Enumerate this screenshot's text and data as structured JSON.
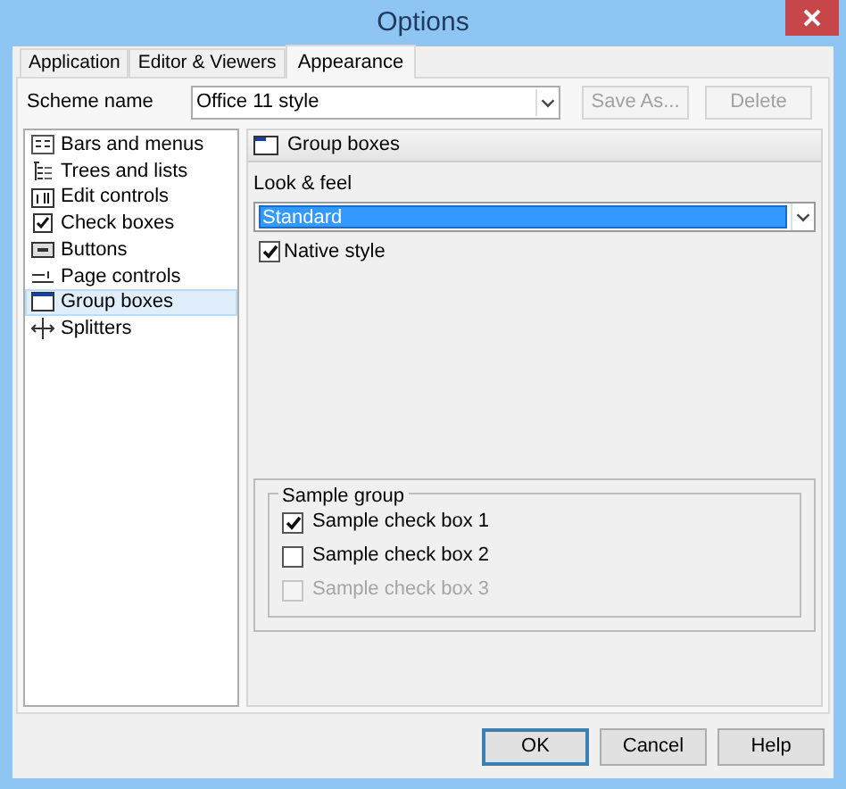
{
  "window": {
    "title": "Options"
  },
  "tabs": [
    {
      "label": "Application",
      "selected": false
    },
    {
      "label": "Editor & Viewers",
      "selected": false
    },
    {
      "label": "Appearance",
      "selected": true
    }
  ],
  "scheme": {
    "label": "Scheme name",
    "value": "Office 11 style",
    "buttons": [
      {
        "label": "Save As...",
        "disabled": true
      },
      {
        "label": "Delete",
        "disabled": true
      }
    ]
  },
  "categories": [
    {
      "label": "Bars and menus",
      "selected": false
    },
    {
      "label": "Trees and lists",
      "selected": false
    },
    {
      "label": "Edit controls",
      "selected": false
    },
    {
      "label": "Check boxes",
      "selected": false
    },
    {
      "label": "Buttons",
      "selected": false
    },
    {
      "label": "Page controls",
      "selected": false
    },
    {
      "label": "Group boxes",
      "selected": true
    },
    {
      "label": "Splitters",
      "selected": false
    }
  ],
  "panel": {
    "title": "Group boxes",
    "look_label": "Look & feel",
    "look_value": "Standard",
    "native_style": {
      "label": "Native style",
      "checked": true
    }
  },
  "sample_group": {
    "title": "Sample group",
    "checkboxes": [
      {
        "label": "Sample check box 1",
        "checked": true,
        "disabled": false
      },
      {
        "label": "Sample check box 2",
        "checked": false,
        "disabled": false
      },
      {
        "label": "Sample check box 3",
        "checked": false,
        "disabled": true
      }
    ]
  },
  "buttons": [
    {
      "label": "OK",
      "default": true
    },
    {
      "label": "Cancel",
      "default": false
    },
    {
      "label": "Help",
      "default": false
    }
  ]
}
